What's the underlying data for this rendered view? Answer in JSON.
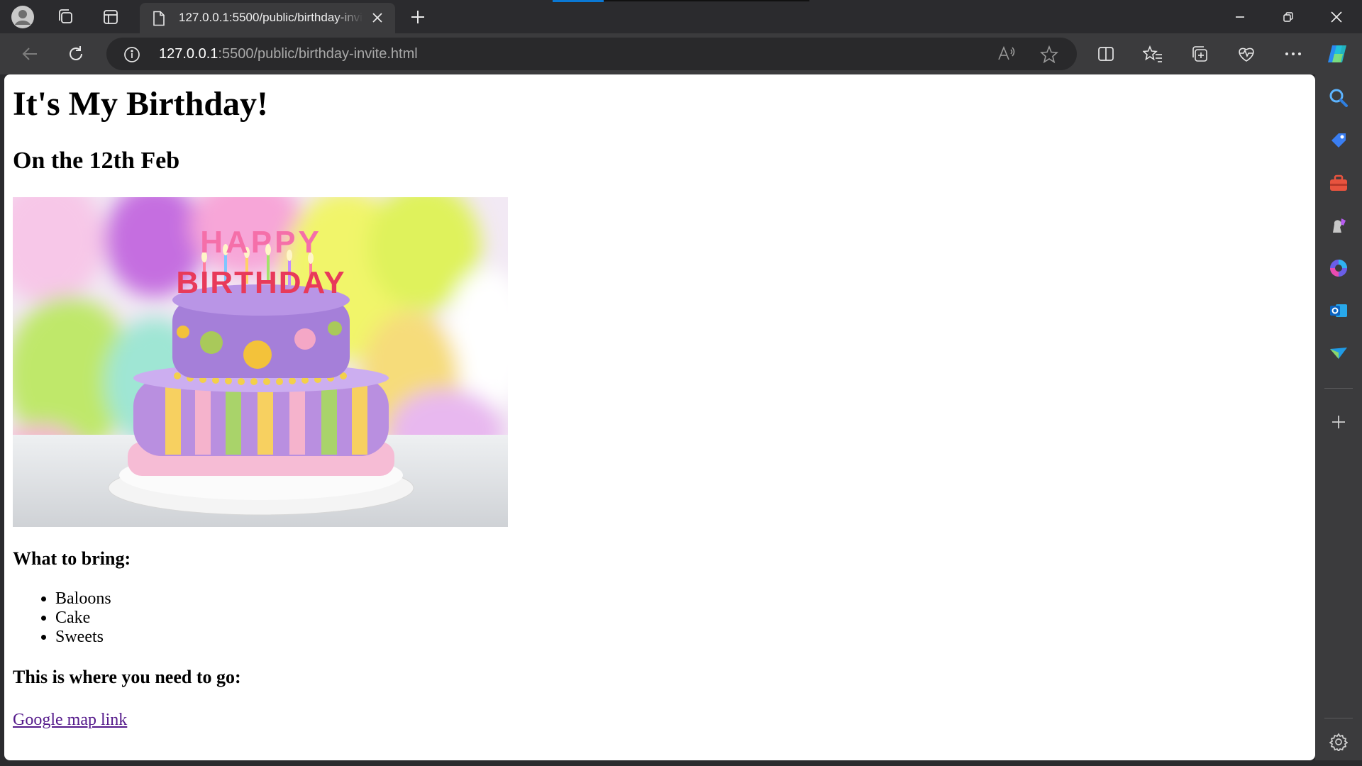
{
  "browser": {
    "tab": {
      "title": "127.0.0.1:5500/public/birthday-invite.html"
    },
    "address": {
      "host": "127.0.0.1",
      "path": ":5500/public/birthday-invite.html"
    }
  },
  "page": {
    "heading": "It's My Birthday!",
    "date": "On the 12th Feb",
    "bring_heading": "What to bring:",
    "bring_items": [
      "Baloons",
      "Cake",
      "Sweets"
    ],
    "where_heading": "This is where you need to go:",
    "map_link": "Google map link"
  },
  "hero_image_text": "HAPPY BIRTHDAY",
  "colors": {
    "chrome_dark": "#2b2b2e",
    "chrome_toolbar": "#3b3b3d",
    "accent": "#0a78d4",
    "visited_link": "#551a8b"
  },
  "icons": {
    "titlebar": [
      "profile-icon",
      "workspaces-icon",
      "vertical-tabs-icon",
      "page-icon",
      "close-icon",
      "new-tab-icon"
    ],
    "toolbar": [
      "back-icon",
      "refresh-icon",
      "info-icon",
      "read-aloud-icon",
      "favorite-star-icon",
      "split-screen-icon",
      "favorites-icon",
      "collections-icon",
      "browser-essentials-icon",
      "more-icon",
      "copilot-icon"
    ],
    "sidebar": [
      "search-icon",
      "shopping-icon",
      "tools-icon",
      "games-icon",
      "m365-icon",
      "outlook-icon",
      "send-icon",
      "add-icon",
      "settings-icon"
    ]
  }
}
